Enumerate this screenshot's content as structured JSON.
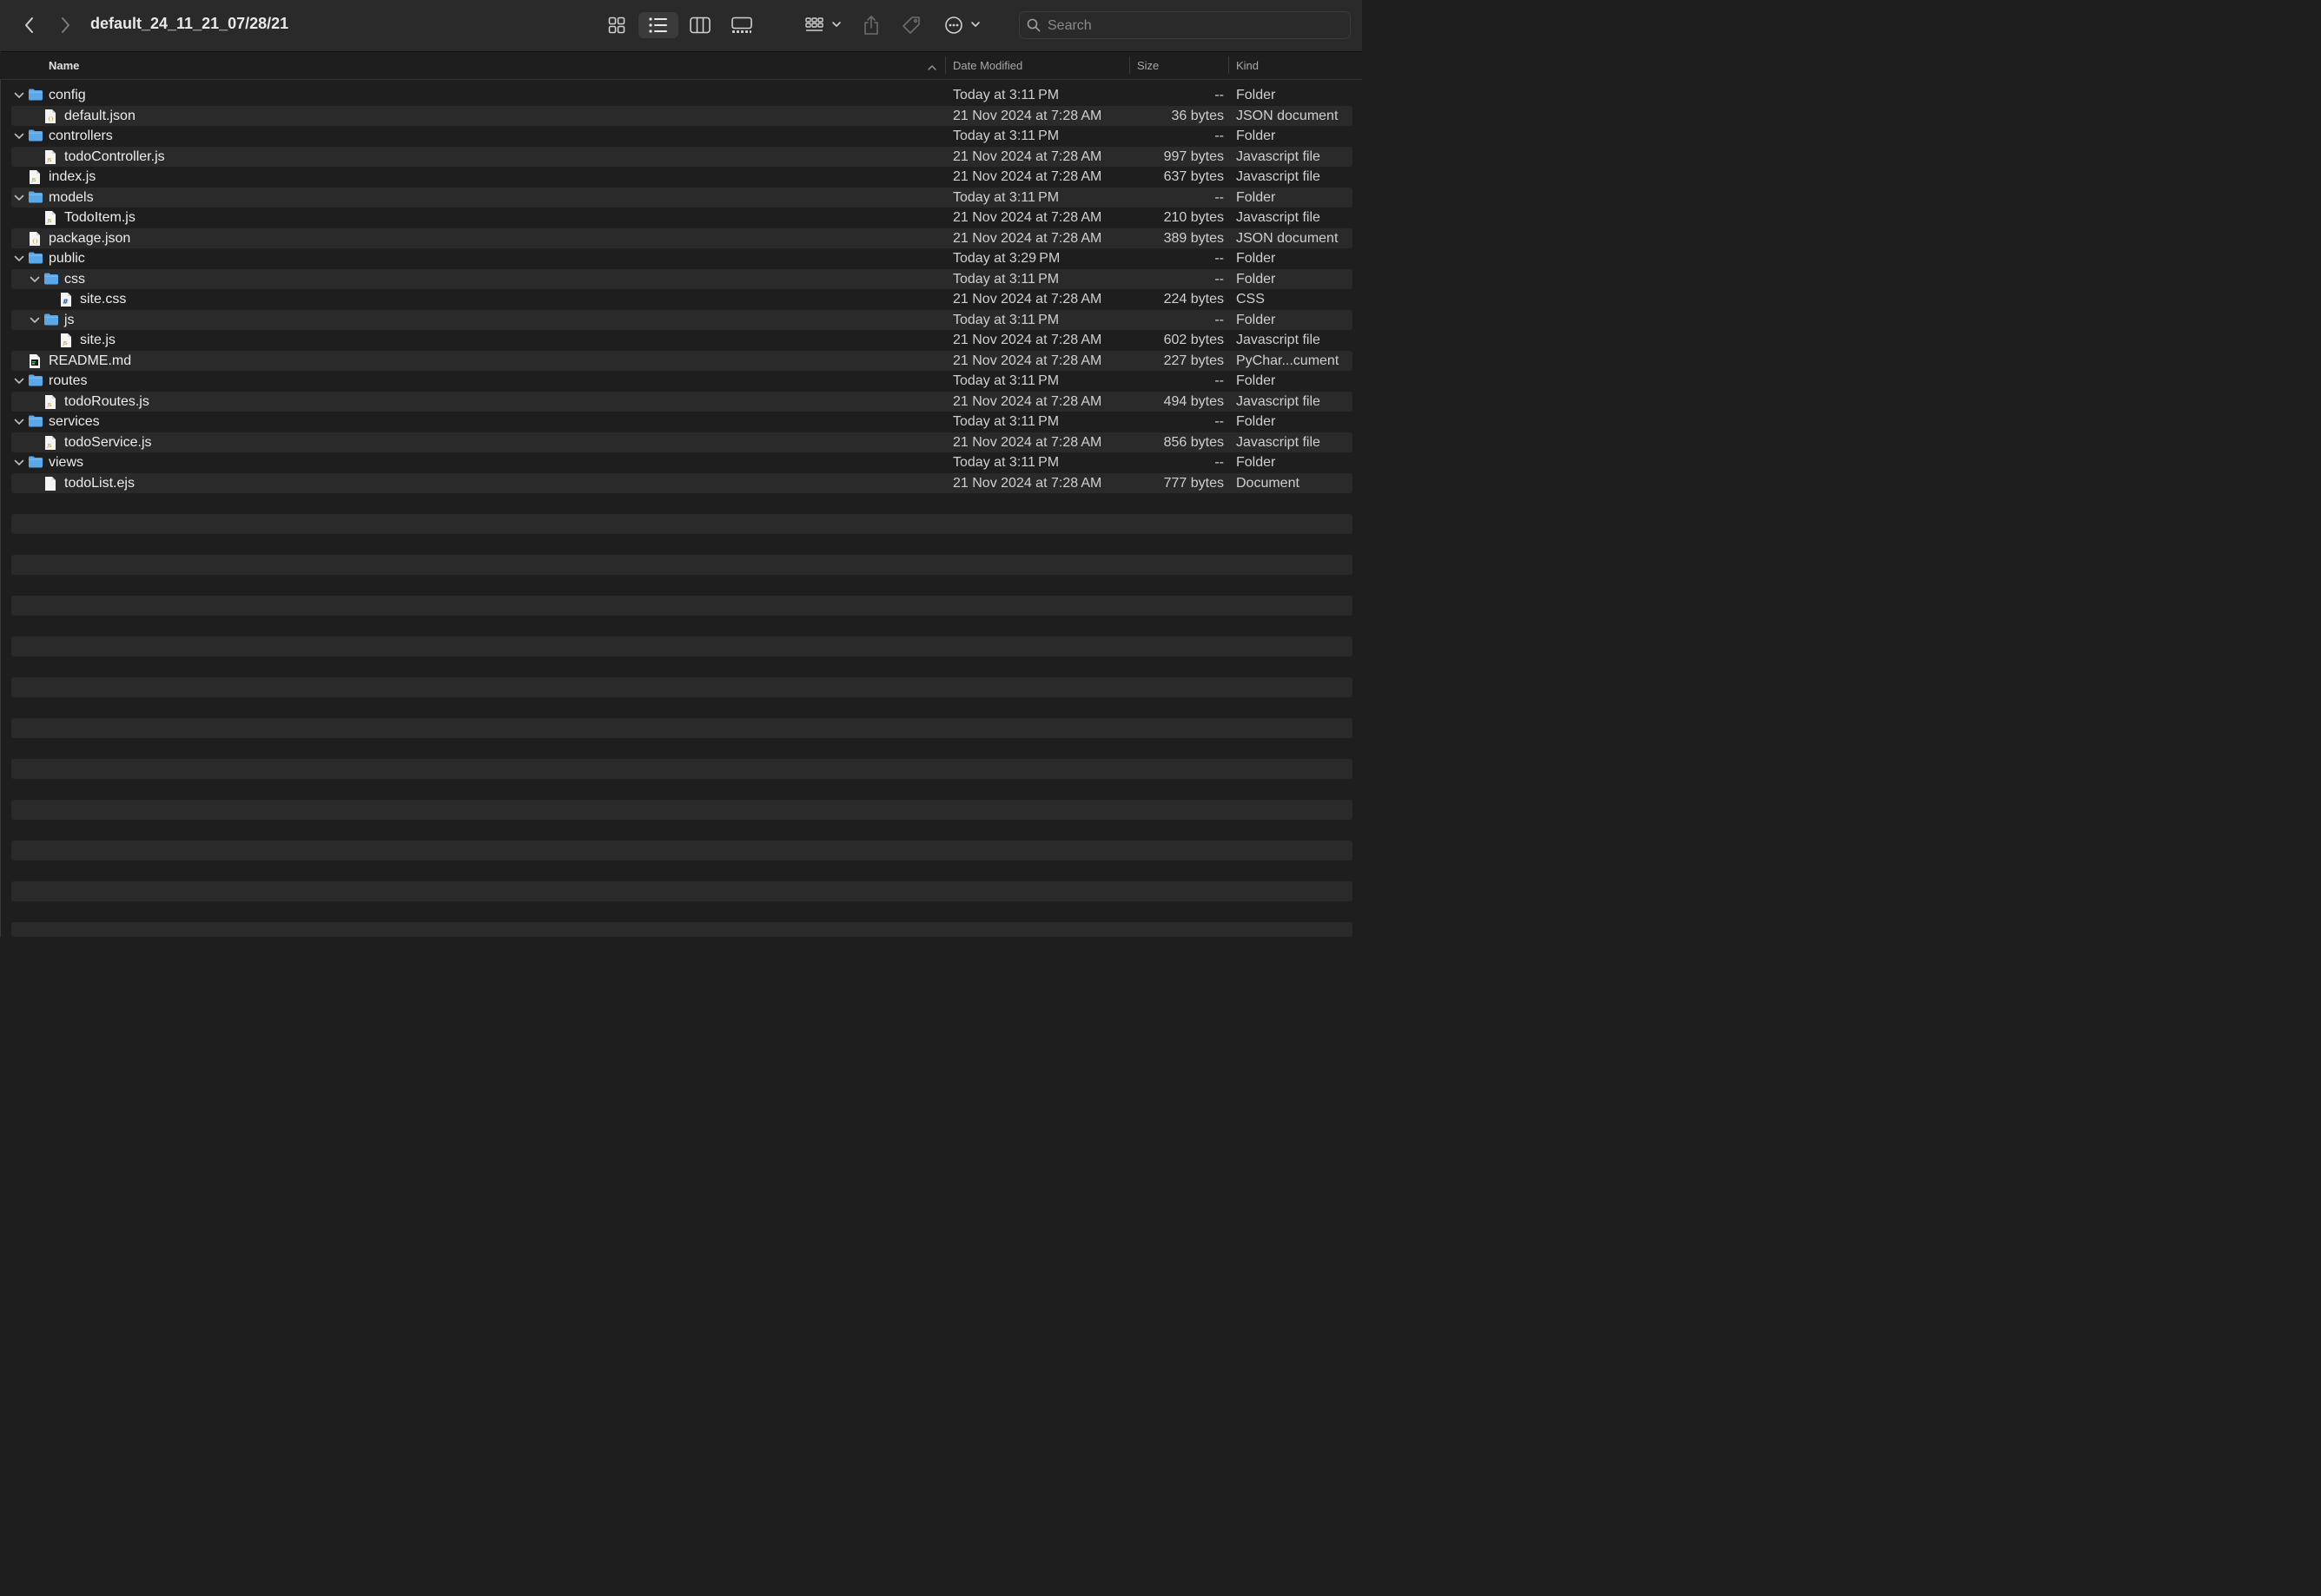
{
  "window": {
    "title": "default_24_11_21_07/28/21"
  },
  "toolbar": {
    "back_icon": "chevron-left-icon",
    "forward_icon": "chevron-right-icon",
    "view_icons": [
      "grid-view-icon",
      "list-view-icon",
      "column-view-icon",
      "gallery-view-icon"
    ],
    "selected_view": "list",
    "group_icon": "group-by-icon",
    "share_icon": "share-icon",
    "tag_icon": "tag-icon",
    "more_icon": "ellipsis-circle-icon"
  },
  "search": {
    "placeholder": "Search",
    "value": ""
  },
  "columns": {
    "name": "Name",
    "date": "Date Modified",
    "size": "Size",
    "kind": "Kind"
  },
  "colors": {
    "folder": "#5aa8e8",
    "background": "#1e1e1e",
    "row_alt": "#2a2a2a"
  },
  "rows": [
    {
      "name": "config",
      "date": "Today at 3:11 PM",
      "size": "--",
      "kind": "Folder",
      "type": "folder",
      "depth": 0,
      "expanded": true
    },
    {
      "name": "default.json",
      "date": "21 Nov 2024 at 7:28 AM",
      "size": "36 bytes",
      "kind": "JSON document",
      "type": "json",
      "depth": 1
    },
    {
      "name": "controllers",
      "date": "Today at 3:11 PM",
      "size": "--",
      "kind": "Folder",
      "type": "folder",
      "depth": 0,
      "expanded": true
    },
    {
      "name": "todoController.js",
      "date": "21 Nov 2024 at 7:28 AM",
      "size": "997 bytes",
      "kind": "Javascript file",
      "type": "js",
      "depth": 1
    },
    {
      "name": "index.js",
      "date": "21 Nov 2024 at 7:28 AM",
      "size": "637 bytes",
      "kind": "Javascript file",
      "type": "js",
      "depth": 0
    },
    {
      "name": "models",
      "date": "Today at 3:11 PM",
      "size": "--",
      "kind": "Folder",
      "type": "folder",
      "depth": 0,
      "expanded": true
    },
    {
      "name": "TodoItem.js",
      "date": "21 Nov 2024 at 7:28 AM",
      "size": "210 bytes",
      "kind": "Javascript file",
      "type": "js",
      "depth": 1
    },
    {
      "name": "package.json",
      "date": "21 Nov 2024 at 7:28 AM",
      "size": "389 bytes",
      "kind": "JSON document",
      "type": "json",
      "depth": 0
    },
    {
      "name": "public",
      "date": "Today at 3:29 PM",
      "size": "--",
      "kind": "Folder",
      "type": "folder",
      "depth": 0,
      "expanded": true
    },
    {
      "name": "css",
      "date": "Today at 3:11 PM",
      "size": "--",
      "kind": "Folder",
      "type": "folder",
      "depth": 1,
      "expanded": true
    },
    {
      "name": "site.css",
      "date": "21 Nov 2024 at 7:28 AM",
      "size": "224 bytes",
      "kind": "CSS",
      "type": "css",
      "depth": 2
    },
    {
      "name": "js",
      "date": "Today at 3:11 PM",
      "size": "--",
      "kind": "Folder",
      "type": "folder",
      "depth": 1,
      "expanded": true
    },
    {
      "name": "site.js",
      "date": "21 Nov 2024 at 7:28 AM",
      "size": "602 bytes",
      "kind": "Javascript file",
      "type": "js",
      "depth": 2
    },
    {
      "name": "README.md",
      "date": "21 Nov 2024 at 7:28 AM",
      "size": "227 bytes",
      "kind": "PyChar...cument",
      "type": "md",
      "depth": 0
    },
    {
      "name": "routes",
      "date": "Today at 3:11 PM",
      "size": "--",
      "kind": "Folder",
      "type": "folder",
      "depth": 0,
      "expanded": true
    },
    {
      "name": "todoRoutes.js",
      "date": "21 Nov 2024 at 7:28 AM",
      "size": "494 bytes",
      "kind": "Javascript file",
      "type": "js",
      "depth": 1
    },
    {
      "name": "services",
      "date": "Today at 3:11 PM",
      "size": "--",
      "kind": "Folder",
      "type": "folder",
      "depth": 0,
      "expanded": true
    },
    {
      "name": "todoService.js",
      "date": "21 Nov 2024 at 7:28 AM",
      "size": "856 bytes",
      "kind": "Javascript file",
      "type": "js",
      "depth": 1
    },
    {
      "name": "views",
      "date": "Today at 3:11 PM",
      "size": "--",
      "kind": "Folder",
      "type": "folder",
      "depth": 0,
      "expanded": true
    },
    {
      "name": "todoList.ejs",
      "date": "21 Nov 2024 at 7:28 AM",
      "size": "777 bytes",
      "kind": "Document",
      "type": "doc",
      "depth": 1
    }
  ]
}
